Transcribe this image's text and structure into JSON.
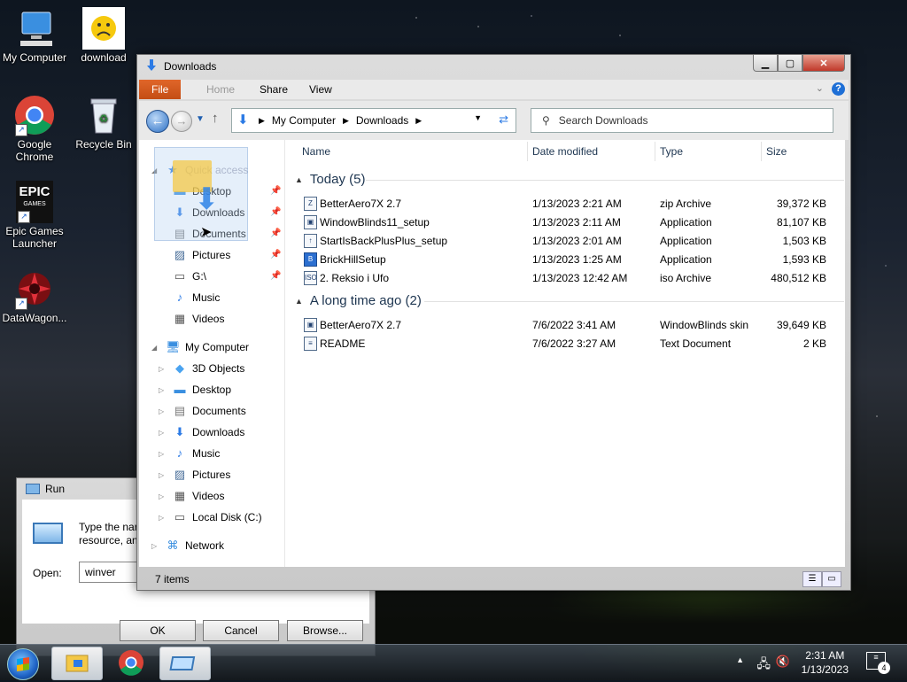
{
  "desktop": {
    "icons": [
      {
        "label": "My Computer"
      },
      {
        "label": "download"
      },
      {
        "label": "Google Chrome"
      },
      {
        "label": "Recycle Bin"
      },
      {
        "label": "Epic Games Launcher",
        "logo_text_1": "EPIC",
        "logo_text_2": "GAMES"
      },
      {
        "label": "DataWagon..."
      }
    ]
  },
  "explorer": {
    "title": "Downloads",
    "ribbon_tabs": [
      "File",
      "Home",
      "Share",
      "View"
    ],
    "help_glyph": "?",
    "address": {
      "crumbs": [
        "My Computer",
        "Downloads"
      ]
    },
    "search_placeholder": "Search Downloads",
    "nav": {
      "quick_access": "Quick access",
      "quick_items": [
        "Desktop",
        "Downloads",
        "Documents",
        "Pictures",
        "G:\\",
        "Music",
        "Videos"
      ],
      "my_computer": "My Computer",
      "computer_items": [
        "3D Objects",
        "Desktop",
        "Documents",
        "Downloads",
        "Music",
        "Pictures",
        "Videos",
        "Local Disk (C:)"
      ],
      "network": "Network"
    },
    "columns": {
      "name": "Name",
      "date": "Date modified",
      "type": "Type",
      "size": "Size"
    },
    "groups": [
      {
        "title": "Today (5)",
        "rows": [
          {
            "name": "BetterAero7X 2.7",
            "date": "1/13/2023 2:21 AM",
            "type": "zip Archive",
            "size": "39,372 KB"
          },
          {
            "name": "WindowBlinds11_setup",
            "date": "1/13/2023 2:11 AM",
            "type": "Application",
            "size": "81,107 KB"
          },
          {
            "name": "StartIsBackPlusPlus_setup",
            "date": "1/13/2023 2:01 AM",
            "type": "Application",
            "size": "1,503 KB"
          },
          {
            "name": "BrickHillSetup",
            "date": "1/13/2023 1:25 AM",
            "type": "Application",
            "size": "1,593 KB"
          },
          {
            "name": "2. Reksio i Ufo",
            "date": "1/13/2023 12:42 AM",
            "type": "iso Archive",
            "size": "480,512 KB"
          }
        ]
      },
      {
        "title": "A long time ago (2)",
        "rows": [
          {
            "name": "BetterAero7X 2.7",
            "date": "7/6/2022 3:41 AM",
            "type": "WindowBlinds skin",
            "size": "39,649 KB"
          },
          {
            "name": "README",
            "date": "7/6/2022 3:27 AM",
            "type": "Text Document",
            "size": "2 KB"
          }
        ]
      }
    ],
    "status_count": "7 items"
  },
  "run_dialog": {
    "title": "Run",
    "message_line1": "Type the nar",
    "message_line2": "resource, an",
    "open_label": "Open:",
    "open_value": "winver",
    "ok": "OK",
    "cancel": "Cancel",
    "browse": "Browse..."
  },
  "taskbar": {
    "time": "2:31 AM",
    "date": "1/13/2023",
    "notification_count": "4"
  },
  "colors": {
    "accent": "#1e6fd6",
    "file_tab": "#d0561a",
    "folder": "#f4c846"
  }
}
